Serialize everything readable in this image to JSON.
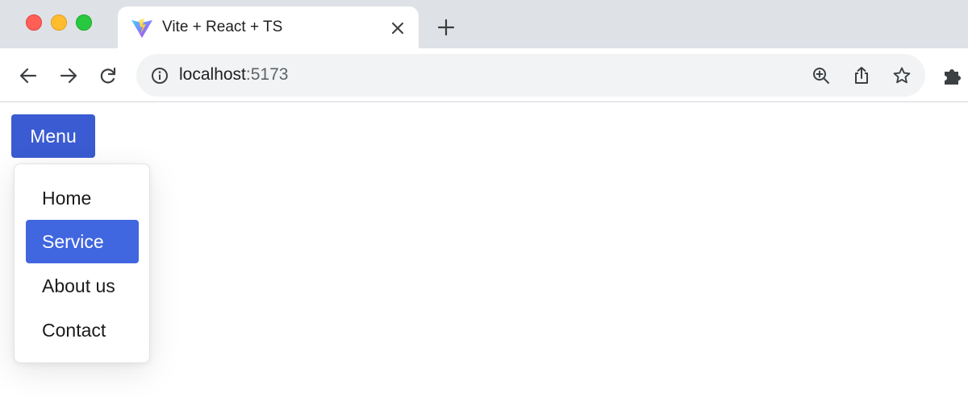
{
  "browser": {
    "tab": {
      "title": "Vite + React + TS",
      "favicon": "vite-logo"
    },
    "address": {
      "host": "localhost",
      "port": ":5173"
    },
    "icons": {
      "back": "arrow-left-icon",
      "forward": "arrow-right-icon",
      "reload": "reload-icon",
      "info": "info-icon",
      "zoom": "zoom-in-icon",
      "share": "share-icon",
      "bookmark": "star-icon",
      "extensions": "puzzle-icon",
      "close": "close-icon",
      "new_tab": "plus-icon"
    }
  },
  "page": {
    "menu_button": {
      "label": "Menu"
    },
    "dropdown": {
      "items": [
        {
          "label": "Home",
          "active": false
        },
        {
          "label": "Service",
          "active": true
        },
        {
          "label": "About us",
          "active": false
        },
        {
          "label": "Contact",
          "active": false
        }
      ]
    }
  },
  "colors": {
    "menu_button_bg": "#3a5bd1",
    "active_item_bg": "#4066e0",
    "tabstrip_bg": "#dee1e6",
    "omnibox_bg": "#f1f3f4"
  }
}
